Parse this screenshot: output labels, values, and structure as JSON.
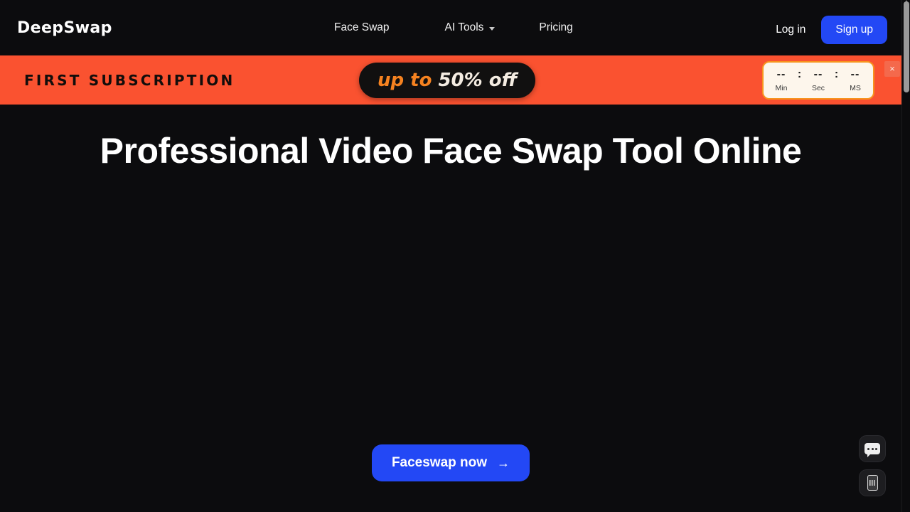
{
  "brand": {
    "name": "DeepSwap"
  },
  "nav": {
    "items": [
      {
        "label": "Face Swap",
        "has_caret": false
      },
      {
        "label": "AI Tools",
        "has_caret": true
      },
      {
        "label": "Pricing",
        "has_caret": false
      }
    ]
  },
  "header_actions": {
    "login_label": "Log in",
    "signup_label": "Sign up",
    "signup_color": "#2348f5"
  },
  "promo": {
    "title": "FIRST SUBSCRIPTION",
    "pill_prefix": "up to",
    "pill_discount": "50% off",
    "background_color": "#fa5230",
    "pill_background": "#111010",
    "prefix_color": "#f58220",
    "discount_color": "#f4ece2",
    "close_icon": "close-icon",
    "close_label": "×",
    "countdown": {
      "minutes": "--",
      "seconds": "--",
      "milliseconds": "--",
      "separator": ":",
      "label_minutes": "Min",
      "label_seconds": "Sec",
      "label_milliseconds": "MS",
      "border_color": "#f7941e",
      "background_color": "#fdf6ec"
    }
  },
  "hero": {
    "title": "Professional Video Face Swap Tool Online",
    "cta_label": "Faceswap now",
    "cta_arrow": "→",
    "cta_color": "#2348f5"
  },
  "floating": {
    "chat_icon": "chat-bubble-icon",
    "mobile_icon": "mobile-device-icon"
  },
  "scrollbar": {
    "up_arrow": "▲"
  }
}
